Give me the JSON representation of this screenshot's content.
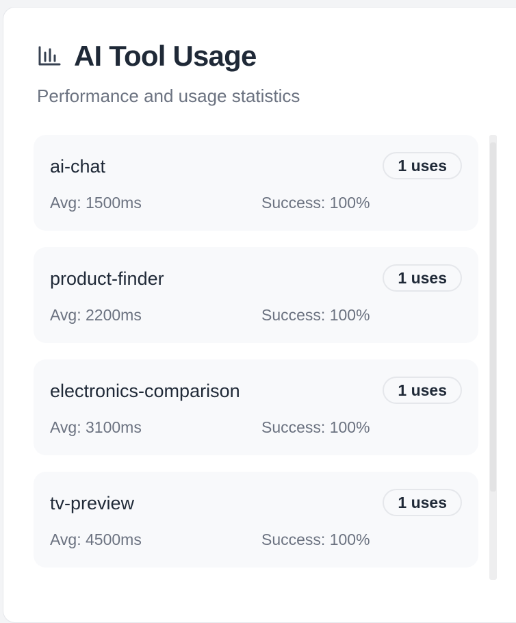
{
  "header": {
    "icon": "bar-chart-icon",
    "title": "AI Tool Usage",
    "subtitle": "Performance and usage statistics"
  },
  "tools": [
    {
      "name": "ai-chat",
      "uses": "1 uses",
      "avg": "Avg: 1500ms",
      "success": "Success: 100%"
    },
    {
      "name": "product-finder",
      "uses": "1 uses",
      "avg": "Avg: 2200ms",
      "success": "Success: 100%"
    },
    {
      "name": "electronics-comparison",
      "uses": "1 uses",
      "avg": "Avg: 3100ms",
      "success": "Success: 100%"
    },
    {
      "name": "tv-preview",
      "uses": "1 uses",
      "avg": "Avg: 4500ms",
      "success": "Success: 100%"
    }
  ],
  "colors": {
    "title": "#1f2937",
    "muted": "#6b7280",
    "item_bg": "#f8f9fb",
    "border": "#e5e7eb"
  }
}
